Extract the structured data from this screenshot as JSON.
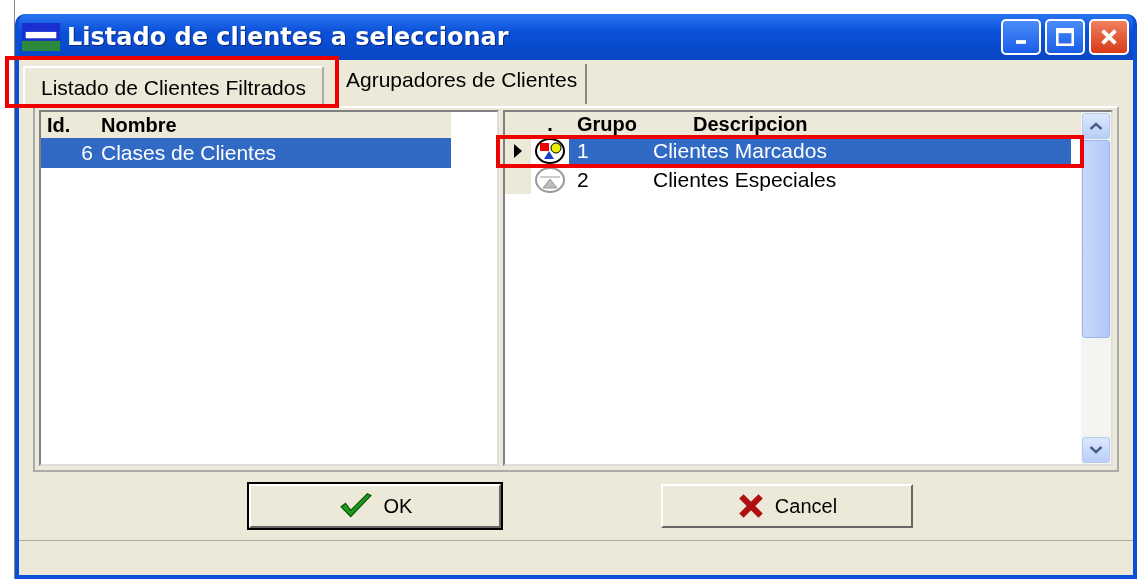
{
  "window": {
    "title": "Listado de clientes a seleccionar"
  },
  "tabs": [
    {
      "label": "Listado de Clientes Filtrados",
      "selected": true
    },
    {
      "label": "Agrupadores de Clientes",
      "selected": false
    }
  ],
  "left_grid": {
    "columns": [
      "Id.",
      "Nombre"
    ],
    "rows": [
      {
        "cells": [
          "6",
          "Clases de Clientes"
        ],
        "selected": true
      }
    ]
  },
  "right_grid": {
    "icon_column_header": ".",
    "columns": [
      "Grupo",
      "Descripcion"
    ],
    "rows": [
      {
        "current": true,
        "selected": true,
        "active": true,
        "cells": [
          "1",
          "Clientes Marcados"
        ]
      },
      {
        "current": false,
        "selected": false,
        "active": false,
        "cells": [
          "2",
          "Clientes Especiales"
        ]
      }
    ]
  },
  "buttons": [
    {
      "label": "OK",
      "kind": "ok"
    },
    {
      "label": "Cancel",
      "kind": "cancel"
    }
  ]
}
